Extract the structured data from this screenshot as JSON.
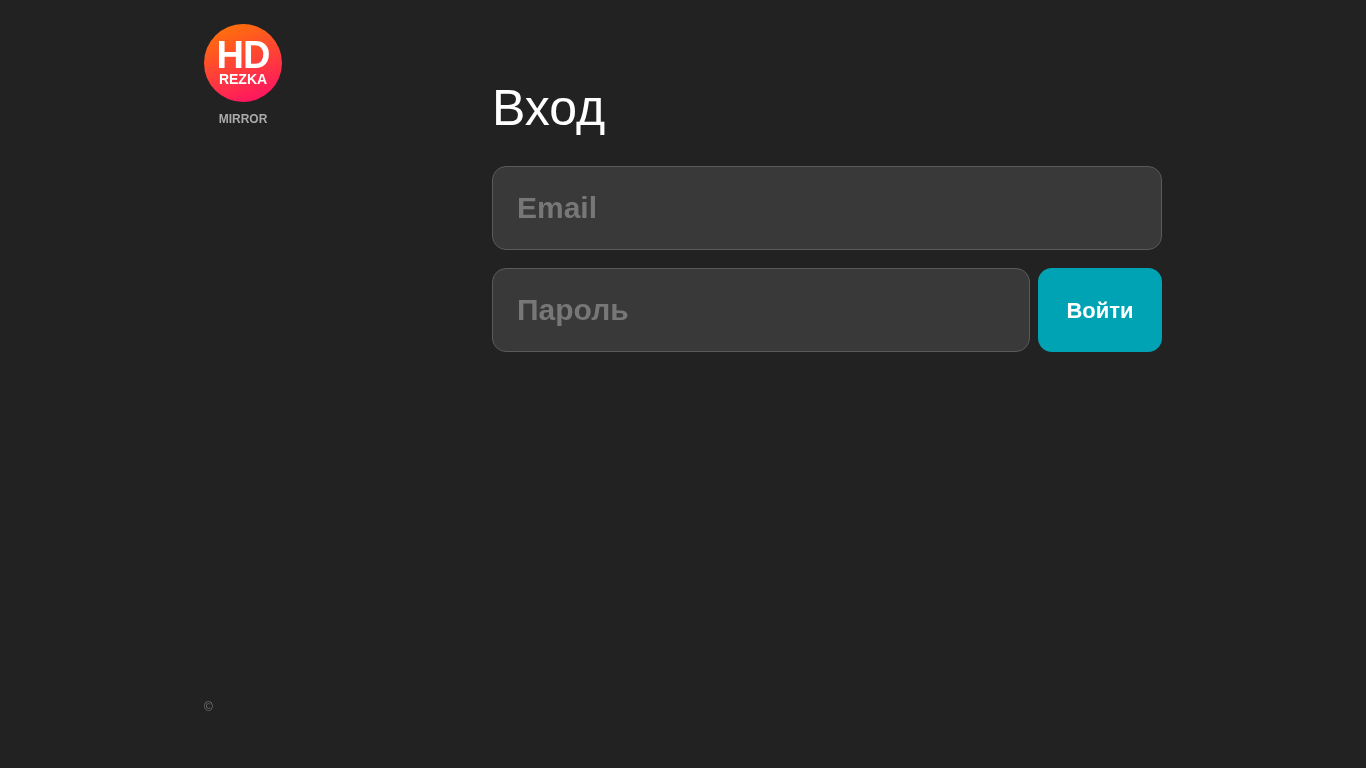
{
  "logo": {
    "title": "HD",
    "subtitle": "REZKA",
    "caption": "MIRROR"
  },
  "heading": "Вход",
  "email_field": {
    "placeholder": "Email"
  },
  "password_field": {
    "placeholder": "Пароль"
  },
  "login_button": "Войти",
  "footer": "©"
}
